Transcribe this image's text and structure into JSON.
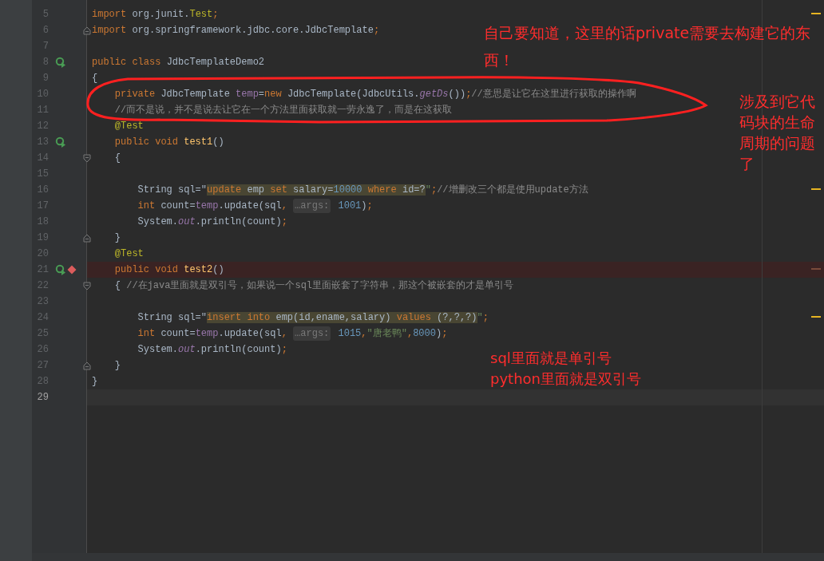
{
  "editor": {
    "lines": [
      {
        "number": "5",
        "current": false,
        "stripe": {
          "kind": "warning"
        },
        "tokens": [
          {
            "text": "import ",
            "kind": "keyword"
          },
          {
            "text": "org.junit.",
            "kind": "plain"
          },
          {
            "text": "Test",
            "kind": "annotation"
          },
          {
            "text": ";",
            "kind": "keyword"
          }
        ]
      },
      {
        "number": "6",
        "current": false,
        "gutter": [
          {
            "kind": "fold-end"
          }
        ],
        "tokens": [
          {
            "text": "import ",
            "kind": "keyword"
          },
          {
            "text": "org.springframework.jdbc.core.JdbcTemplate",
            "kind": "plain"
          },
          {
            "text": ";",
            "kind": "keyword"
          }
        ]
      },
      {
        "number": "7",
        "current": false
      },
      {
        "number": "8",
        "current": false,
        "gutter": [
          {
            "kind": "run"
          }
        ],
        "tokens": [
          {
            "text": "public class ",
            "kind": "keyword"
          },
          {
            "text": "JdbcTemplateDemo2",
            "kind": "plain"
          }
        ]
      },
      {
        "number": "9",
        "current": false,
        "tokens": [
          {
            "text": "{",
            "kind": "plain"
          }
        ]
      },
      {
        "number": "10",
        "current": false,
        "tokens": [
          {
            "text": "    private ",
            "kind": "keyword"
          },
          {
            "text": "JdbcTemplate ",
            "kind": "plain"
          },
          {
            "text": "temp",
            "kind": "field"
          },
          {
            "text": "=",
            "kind": "plain"
          },
          {
            "text": "new ",
            "kind": "keyword"
          },
          {
            "text": "JdbcTemplate(JdbcUtils.",
            "kind": "plain"
          },
          {
            "text": "getDs",
            "kind": "static"
          },
          {
            "text": "())",
            "kind": "plain"
          },
          {
            "text": ";",
            "kind": "keyword"
          },
          {
            "text": "//意思是让它在这里进行获取的操作啊",
            "kind": "comment"
          }
        ]
      },
      {
        "number": "11",
        "current": false,
        "tokens": [
          {
            "text": "    //而不是说，并不是说去让它在一个方法里面获取就一劳永逸了，而是在这获取",
            "kind": "comment"
          }
        ]
      },
      {
        "number": "12",
        "current": false,
        "tokens": [
          {
            "text": "    @Test",
            "kind": "annotation"
          }
        ]
      },
      {
        "number": "13",
        "current": false,
        "gutter": [
          {
            "kind": "run"
          }
        ],
        "tokens": [
          {
            "text": "    public void ",
            "kind": "keyword"
          },
          {
            "text": "test1",
            "kind": "method"
          },
          {
            "text": "()",
            "kind": "plain"
          }
        ]
      },
      {
        "number": "14",
        "current": false,
        "gutter": [
          {
            "kind": "fold-start"
          }
        ],
        "tokens": [
          {
            "text": "    {",
            "kind": "plain"
          }
        ]
      },
      {
        "number": "15",
        "current": false
      },
      {
        "number": "16",
        "current": false,
        "stripe": {
          "kind": "warning"
        },
        "tokens": [
          {
            "text": "        String sql=\"",
            "kind": "plain"
          },
          {
            "text": "update ",
            "kind": "sql-keyword"
          },
          {
            "text": "emp ",
            "kind": "sql-text"
          },
          {
            "text": "set ",
            "kind": "sql-keyword"
          },
          {
            "text": "salary=",
            "kind": "sql-text"
          },
          {
            "text": "10000 ",
            "kind": "sql-number"
          },
          {
            "text": "where ",
            "kind": "sql-keyword"
          },
          {
            "text": "id=?",
            "kind": "sql-text"
          },
          {
            "text": "\"",
            "kind": "string"
          },
          {
            "text": ";",
            "kind": "keyword"
          },
          {
            "text": "//增删改三个都是使用update方法",
            "kind": "comment"
          }
        ]
      },
      {
        "number": "17",
        "current": false,
        "tokens": [
          {
            "text": "        int ",
            "kind": "keyword"
          },
          {
            "text": "count=",
            "kind": "plain"
          },
          {
            "text": "temp",
            "kind": "field"
          },
          {
            "text": ".update(sql",
            "kind": "plain"
          },
          {
            "text": ", ",
            "kind": "keyword"
          },
          {
            "text": "…args:",
            "kind": "hint"
          },
          {
            "text": " 1001",
            "kind": "number"
          },
          {
            "text": ")",
            "kind": "plain"
          },
          {
            "text": ";",
            "kind": "keyword"
          }
        ]
      },
      {
        "number": "18",
        "current": false,
        "tokens": [
          {
            "text": "        System.",
            "kind": "plain"
          },
          {
            "text": "out",
            "kind": "static"
          },
          {
            "text": ".println(count)",
            "kind": "plain"
          },
          {
            "text": ";",
            "kind": "keyword"
          }
        ]
      },
      {
        "number": "19",
        "current": false,
        "gutter": [
          {
            "kind": "fold-end"
          }
        ],
        "tokens": [
          {
            "text": "    }",
            "kind": "plain"
          }
        ]
      },
      {
        "number": "20",
        "current": false,
        "tokens": [
          {
            "text": "    @Test",
            "kind": "annotation"
          }
        ]
      },
      {
        "number": "21",
        "current": false,
        "stripe": {
          "kind": "breakpoint"
        },
        "gutter": [
          {
            "kind": "run"
          },
          {
            "kind": "breakpoint"
          }
        ],
        "tokens": [
          {
            "text": "    public void ",
            "kind": "keyword"
          },
          {
            "text": "test2",
            "kind": "method"
          },
          {
            "text": "()",
            "kind": "plain"
          }
        ]
      },
      {
        "number": "22",
        "current": false,
        "gutter": [
          {
            "kind": "fold-start"
          }
        ],
        "tokens": [
          {
            "text": "    { ",
            "kind": "plain"
          },
          {
            "text": "//在java里面就是双引号，如果说一个sql里面嵌套了字符串，那这个被嵌套的才是单引号",
            "kind": "comment"
          }
        ]
      },
      {
        "number": "23",
        "current": false
      },
      {
        "number": "24",
        "current": false,
        "stripe": {
          "kind": "warning"
        },
        "tokens": [
          {
            "text": "        String sql=\"",
            "kind": "plain"
          },
          {
            "text": "insert into ",
            "kind": "sql-keyword"
          },
          {
            "text": "emp(id,ename,salary) ",
            "kind": "sql-text"
          },
          {
            "text": "values ",
            "kind": "sql-keyword"
          },
          {
            "text": "(?,?,?)",
            "kind": "sql-text"
          },
          {
            "text": "\"",
            "kind": "string"
          },
          {
            "text": ";",
            "kind": "keyword"
          }
        ]
      },
      {
        "number": "25",
        "current": false,
        "tokens": [
          {
            "text": "        int ",
            "kind": "keyword"
          },
          {
            "text": "count=",
            "kind": "plain"
          },
          {
            "text": "temp",
            "kind": "field"
          },
          {
            "text": ".update(sql",
            "kind": "plain"
          },
          {
            "text": ", ",
            "kind": "keyword"
          },
          {
            "text": "…args:",
            "kind": "hint"
          },
          {
            "text": " 1015",
            "kind": "number"
          },
          {
            "text": ",",
            "kind": "keyword"
          },
          {
            "text": "\"唐老鸭\"",
            "kind": "string"
          },
          {
            "text": ",",
            "kind": "keyword"
          },
          {
            "text": "8000",
            "kind": "number"
          },
          {
            "text": ")",
            "kind": "plain"
          },
          {
            "text": ";",
            "kind": "keyword"
          }
        ]
      },
      {
        "number": "26",
        "current": false,
        "tokens": [
          {
            "text": "        System.",
            "kind": "plain"
          },
          {
            "text": "out",
            "kind": "static"
          },
          {
            "text": ".println(count)",
            "kind": "plain"
          },
          {
            "text": ";",
            "kind": "keyword"
          }
        ]
      },
      {
        "number": "27",
        "current": false,
        "gutter": [
          {
            "kind": "fold-end"
          }
        ],
        "tokens": [
          {
            "text": "    }",
            "kind": "plain"
          }
        ]
      },
      {
        "number": "28",
        "current": false,
        "tokens": [
          {
            "text": "}",
            "kind": "plain"
          }
        ]
      },
      {
        "number": "29",
        "current": true
      }
    ],
    "annotations": [
      {
        "kind": "wide",
        "text": "自己要知道，这里的话private需要去构建它的东西！"
      },
      {
        "kind": "narrow",
        "text": "涉及到它代码块的生命周期的问题了"
      },
      {
        "kind": "line-a",
        "text": "sql里面就是单引号"
      },
      {
        "kind": "line-b",
        "text": "python里面就是双引号"
      }
    ]
  }
}
